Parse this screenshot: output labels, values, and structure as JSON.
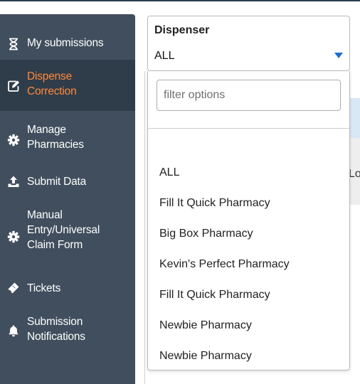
{
  "sidebar": {
    "items": [
      {
        "label": "My submissions",
        "icon": "hourglass-icon",
        "active": false
      },
      {
        "label": "Dispense\nCorrection",
        "icon": "edit-icon",
        "active": true
      },
      {
        "label": "Manage\nPharmacies",
        "icon": "gear-icon",
        "active": false
      },
      {
        "label": "Submit Data",
        "icon": "upload-icon",
        "active": false
      },
      {
        "label": "Manual\nEntry/Universal\nClaim Form",
        "icon": "gear-icon",
        "active": false
      },
      {
        "label": "Tickets",
        "icon": "ticket-icon",
        "active": false
      },
      {
        "label": "Submission\nNotifications",
        "icon": "bell-icon",
        "active": false
      }
    ]
  },
  "dispenser": {
    "label": "Dispenser",
    "selected": "ALL",
    "filter_placeholder": "filter options",
    "options": [
      "ALL",
      "Fill It Quick Pharmacy",
      "Big Box Pharmacy",
      "Kevin's Perfect Pharmacy",
      "Fill It Quick Pharmacy",
      "Newbie Pharmacy",
      "Newbie Pharmacy"
    ]
  },
  "background": {
    "partial_text": "Lo"
  },
  "colors": {
    "sidebar_bg": "#404e5d",
    "sidebar_active_bg": "#2f3c49",
    "active_text": "#ff8a3d",
    "caret": "#1a6fd1"
  }
}
